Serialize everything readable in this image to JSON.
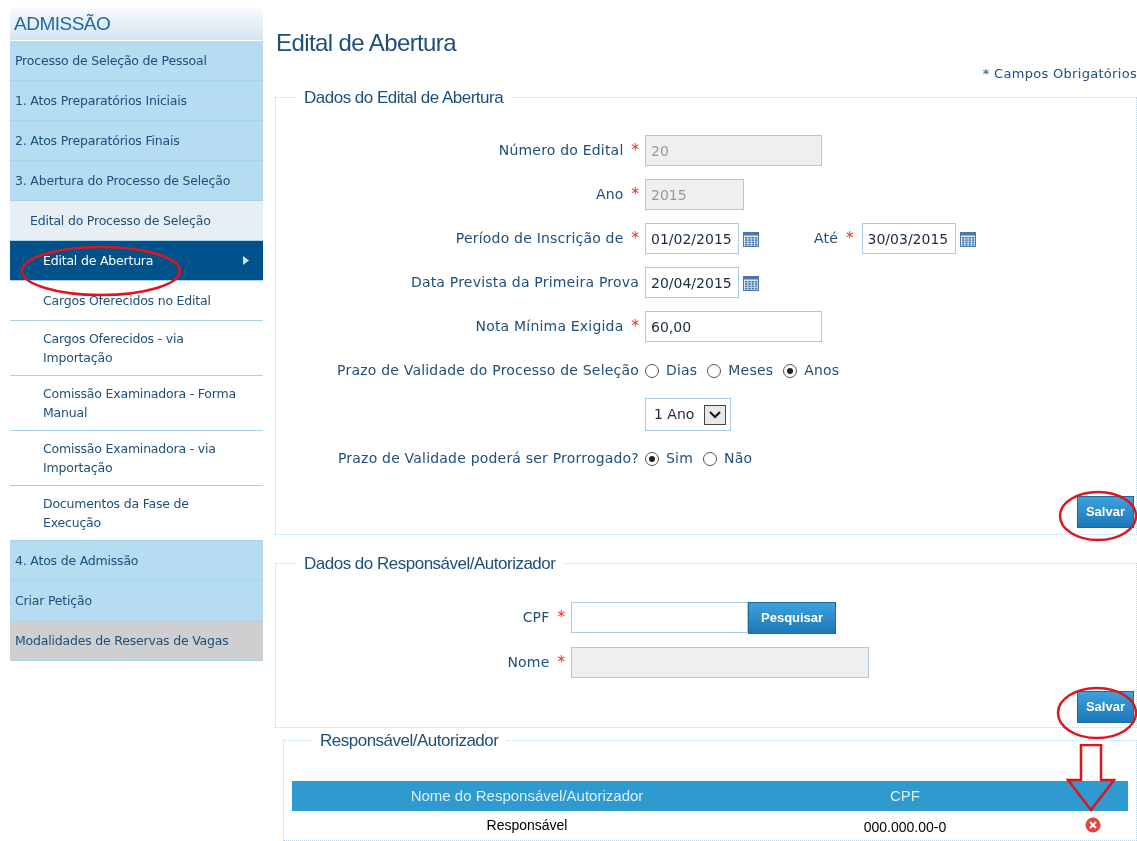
{
  "sidebar": {
    "title": "ADMISSÃO",
    "items": [
      {
        "label": "Processo de Seleção de Pessoal",
        "kind": "module",
        "selected": false
      },
      {
        "label": "1. Atos Preparatórios Iniciais",
        "kind": "module",
        "selected": false
      },
      {
        "label": "2. Atos Preparatórios Finais",
        "kind": "module",
        "selected": false
      },
      {
        "label": "3. Abertura do Processo de Seleção",
        "kind": "module",
        "selected": false,
        "children": [
          {
            "label": "Edital do Processo de Seleção",
            "selected": false,
            "children": [
              {
                "label": "Edital de Abertura",
                "selected": true
              },
              {
                "label": "Cargos Oferecidos no Edital",
                "selected": false
              },
              {
                "label": "Cargos Oferecidos - via Importação",
                "selected": false
              },
              {
                "label": "Comissão Examinadora - Forma Manual",
                "selected": false
              },
              {
                "label": "Comissão Examinadora - via Importação",
                "selected": false
              },
              {
                "label": "Documentos da Fase de Execução",
                "selected": false
              }
            ]
          }
        ]
      },
      {
        "label": "4. Atos de Admissão",
        "kind": "module",
        "selected": false
      },
      {
        "label": "Criar Petição",
        "kind": "module",
        "selected": false
      },
      {
        "label": "Modalidades de Reservas de Vagas",
        "kind": "other",
        "selected": false
      }
    ]
  },
  "title": "Edital de Abertura",
  "required_note": "* Campos Obrigatórios",
  "edital_section": {
    "title": "Dados do Edital de Abertura",
    "rows": [
      {
        "kind": "text",
        "label": "Número do Edital",
        "required_mark": "*",
        "value": "20",
        "disabled": true
      },
      {
        "kind": "short_text",
        "label": "Ano",
        "required_mark": "*",
        "value": "2015",
        "disabled": true
      },
      {
        "kind": "date_range",
        "label": "Período de Inscrição de",
        "required_mark": "*",
        "value": "01/02/2015",
        "to_label": "Até",
        "to_mark": "*",
        "to_value": "30/03/2015"
      },
      {
        "kind": "date",
        "label": "Data Prevista da Primeira Prova",
        "value": "20/04/2015"
      },
      {
        "kind": "text",
        "label": "Nota Mínima Exigida",
        "required_mark": "*",
        "value": "60,00",
        "disabled": false
      },
      {
        "kind": "radio",
        "label": "Prazo de Validade do Processo de Seleção",
        "options": [
          {
            "label": "Dias",
            "selected": false
          },
          {
            "label": "Meses",
            "selected": false
          },
          {
            "label": "Anos",
            "selected": true
          }
        ]
      },
      {
        "kind": "select",
        "value": "1 Ano"
      },
      {
        "kind": "radio",
        "label": "Prazo de Validade poderá ser Prorrogado?",
        "options": [
          {
            "label": "Sim",
            "selected": true
          },
          {
            "label": "Não",
            "selected": false
          }
        ]
      }
    ],
    "save_button": "Salvar"
  },
  "responsavel_section": {
    "title": "Dados do Responsável/Autorizador",
    "cpf_label": "CPF",
    "cpf_mark": "*",
    "search_button": "Pesquisar",
    "nome_label": "Nome",
    "nome_mark": "*",
    "save_button": "Salvar"
  },
  "table_section": {
    "title": "Responsável/Autorizador",
    "columns": [
      "Nome do Responsável/Autorizador",
      "CPF"
    ],
    "rows": [
      {
        "name": "Responsável",
        "cpf": "000.000.00-0"
      }
    ]
  }
}
